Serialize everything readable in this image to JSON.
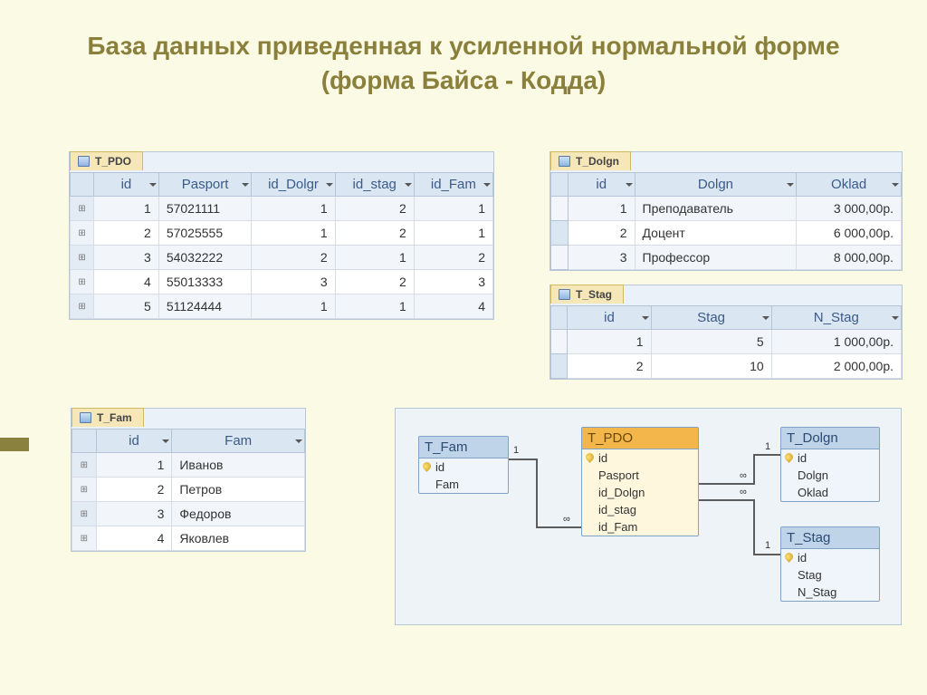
{
  "title": "База данных приведенная к усиленной нормальной форме  (форма Байса - Кодда)",
  "tables": {
    "pdo": {
      "name": "T_PDO",
      "cols": [
        "id",
        "Pasport",
        "id_Dolgr",
        "id_stag",
        "id_Fam"
      ],
      "rows": [
        [
          "1",
          "57021111",
          "1",
          "2",
          "1"
        ],
        [
          "2",
          "57025555",
          "1",
          "2",
          "1"
        ],
        [
          "3",
          "54032222",
          "2",
          "1",
          "2"
        ],
        [
          "4",
          "55013333",
          "3",
          "2",
          "3"
        ],
        [
          "5",
          "51124444",
          "1",
          "1",
          "4"
        ]
      ]
    },
    "dolgn": {
      "name": "T_Dolgn",
      "cols": [
        "id",
        "Dolgn",
        "Oklad"
      ],
      "rows": [
        [
          "1",
          "Преподаватель",
          "3 000,00р."
        ],
        [
          "2",
          "Доцент",
          "6 000,00р."
        ],
        [
          "3",
          "Профессор",
          "8 000,00р."
        ]
      ]
    },
    "stag": {
      "name": "T_Stag",
      "cols": [
        "id",
        "Stag",
        "N_Stag"
      ],
      "rows": [
        [
          "1",
          "5",
          "1 000,00р."
        ],
        [
          "2",
          "10",
          "2 000,00р."
        ]
      ]
    },
    "fam": {
      "name": "T_Fam",
      "cols": [
        "id",
        "Fam"
      ],
      "rows": [
        [
          "1",
          "Иванов"
        ],
        [
          "2",
          "Петров"
        ],
        [
          "3",
          "Федоров"
        ],
        [
          "4",
          "Яковлев"
        ]
      ]
    }
  },
  "diagram": {
    "entities": {
      "fam": {
        "title": "T_Fam",
        "fields": [
          {
            "n": "id",
            "pk": true
          },
          {
            "n": "Fam"
          }
        ]
      },
      "pdo": {
        "title": "T_PDO",
        "fields": [
          {
            "n": "id",
            "pk": true
          },
          {
            "n": "Pasport"
          },
          {
            "n": "id_Dolgn"
          },
          {
            "n": "id_stag"
          },
          {
            "n": "id_Fam"
          }
        ]
      },
      "dolgn": {
        "title": "T_Dolgn",
        "fields": [
          {
            "n": "id",
            "pk": true
          },
          {
            "n": "Dolgn"
          },
          {
            "n": "Oklad"
          }
        ]
      },
      "stag": {
        "title": "T_Stag",
        "fields": [
          {
            "n": "id",
            "pk": true
          },
          {
            "n": "Stag"
          },
          {
            "n": "N_Stag"
          }
        ]
      }
    },
    "labels": {
      "one": "1",
      "many": "∞"
    }
  }
}
